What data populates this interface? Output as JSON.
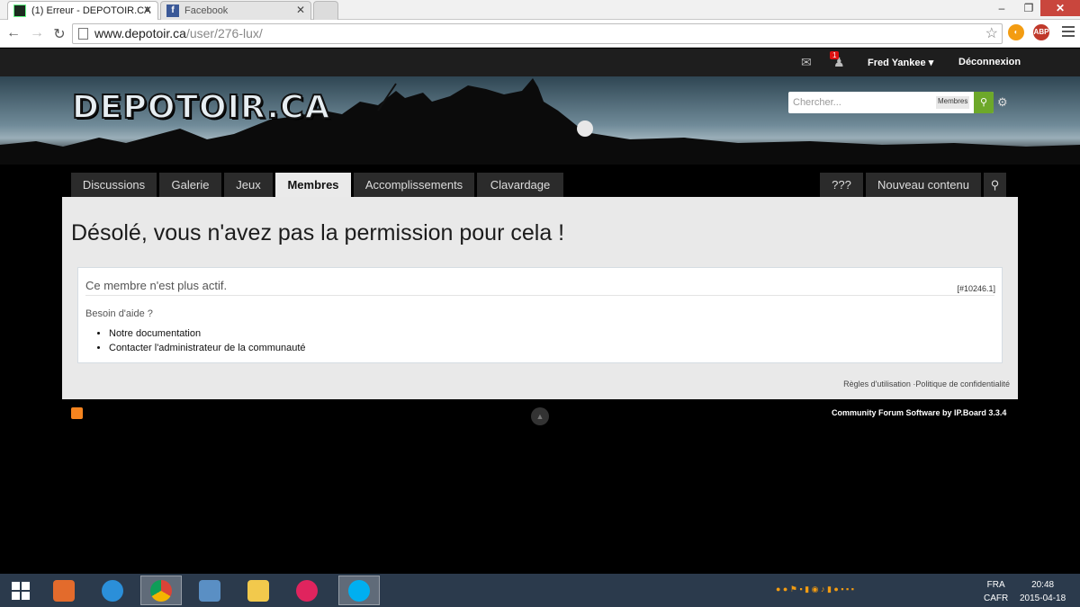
{
  "browser": {
    "tabs": [
      {
        "title": "(1) Erreur - DEPOTOIR.CA",
        "active": true
      },
      {
        "title": "Facebook",
        "active": false
      }
    ],
    "url_host": "www.depotoir.ca",
    "url_path": "/user/276-lux/"
  },
  "userbar": {
    "notification_count": "1",
    "username": "Fred Yankee",
    "logout": "Déconnexion"
  },
  "site": {
    "logo": "DEPOTOIR.CA",
    "search": {
      "placeholder": "Chercher...",
      "scope": "Membres"
    }
  },
  "nav": {
    "tabs": [
      "Discussions",
      "Galerie",
      "Jeux",
      "Membres",
      "Accomplissements",
      "Clavardage"
    ],
    "active_tab": "Membres",
    "right_tabs": [
      "???",
      "Nouveau contenu"
    ]
  },
  "error": {
    "title": "Désolé, vous n'avez pas la permission pour cela !",
    "message": "Ce membre n'est plus actif.",
    "code": "[#10246.1]",
    "help": "Besoin d'aide ?",
    "links": [
      "Notre documentation",
      "Contacter l'administrateur de la communauté"
    ]
  },
  "footer": {
    "terms": "Règles d'utilisation",
    "separator": " ·",
    "privacy": "Politique de confidentialité",
    "powered": "Community Forum Software by IP.Board 3.3.4"
  },
  "taskbar": {
    "lang": "FRA",
    "layout": "CAFR",
    "time": "20:48",
    "date": "2015-04-18"
  },
  "colors": {
    "accent_green": "#6da82a",
    "userbar_bg": "#1e1e1e",
    "taskbar_bg": "#2b3a4c"
  }
}
